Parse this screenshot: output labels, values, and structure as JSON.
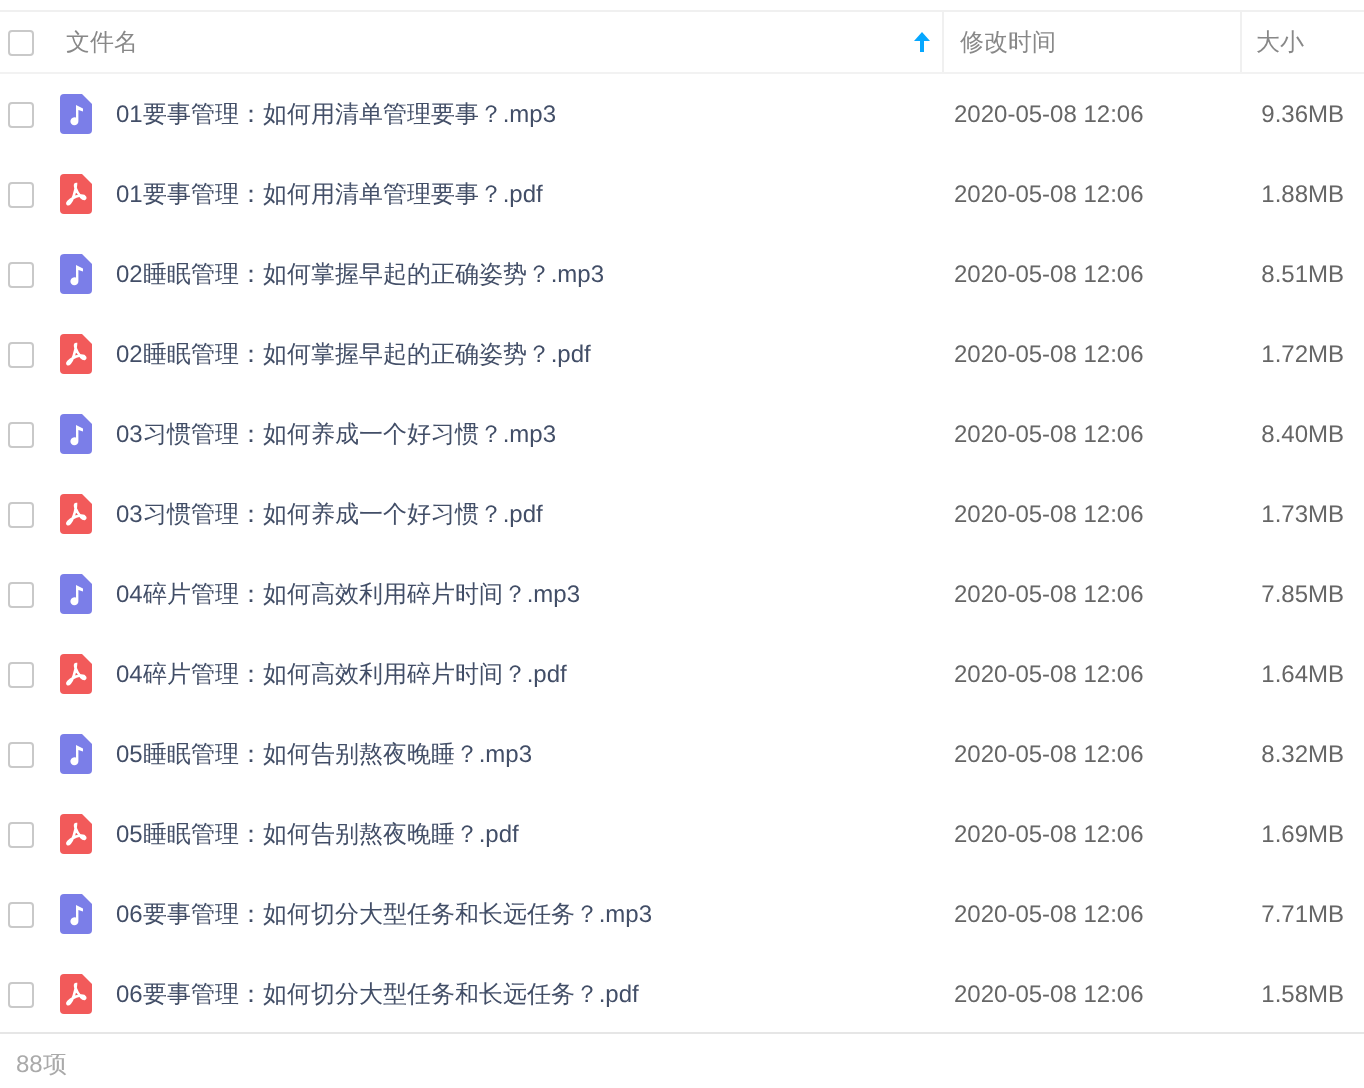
{
  "header": {
    "checked": false,
    "name": "文件名",
    "sort_ascending": true,
    "modified": "修改时间",
    "size": "大小"
  },
  "files": [
    {
      "kind": "audio",
      "checked": false,
      "name": "01要事管理：如何用清单管理要事？.mp3",
      "modified": "2020-05-08 12:06",
      "size": "9.36MB"
    },
    {
      "kind": "pdf",
      "checked": false,
      "name": "01要事管理：如何用清单管理要事？.pdf",
      "modified": "2020-05-08 12:06",
      "size": "1.88MB"
    },
    {
      "kind": "audio",
      "checked": false,
      "name": "02睡眠管理：如何掌握早起的正确姿势？.mp3",
      "modified": "2020-05-08 12:06",
      "size": "8.51MB"
    },
    {
      "kind": "pdf",
      "checked": false,
      "name": "02睡眠管理：如何掌握早起的正确姿势？.pdf",
      "modified": "2020-05-08 12:06",
      "size": "1.72MB"
    },
    {
      "kind": "audio",
      "checked": false,
      "name": "03习惯管理：如何养成一个好习惯？.mp3",
      "modified": "2020-05-08 12:06",
      "size": "8.40MB"
    },
    {
      "kind": "pdf",
      "checked": false,
      "name": "03习惯管理：如何养成一个好习惯？.pdf",
      "modified": "2020-05-08 12:06",
      "size": "1.73MB"
    },
    {
      "kind": "audio",
      "checked": false,
      "name": "04碎片管理：如何高效利用碎片时间？.mp3",
      "modified": "2020-05-08 12:06",
      "size": "7.85MB"
    },
    {
      "kind": "pdf",
      "checked": false,
      "name": "04碎片管理：如何高效利用碎片时间？.pdf",
      "modified": "2020-05-08 12:06",
      "size": "1.64MB"
    },
    {
      "kind": "audio",
      "checked": false,
      "name": "05睡眠管理：如何告别熬夜晚睡？.mp3",
      "modified": "2020-05-08 12:06",
      "size": "8.32MB"
    },
    {
      "kind": "pdf",
      "checked": false,
      "name": "05睡眠管理：如何告别熬夜晚睡？.pdf",
      "modified": "2020-05-08 12:06",
      "size": "1.69MB"
    },
    {
      "kind": "audio",
      "checked": false,
      "name": "06要事管理：如何切分大型任务和长远任务？.mp3",
      "modified": "2020-05-08 12:06",
      "size": "7.71MB"
    },
    {
      "kind": "pdf",
      "checked": false,
      "name": "06要事管理：如何切分大型任务和长远任务？.pdf",
      "modified": "2020-05-08 12:06",
      "size": "1.58MB"
    }
  ],
  "footer": {
    "count": "88项"
  }
}
